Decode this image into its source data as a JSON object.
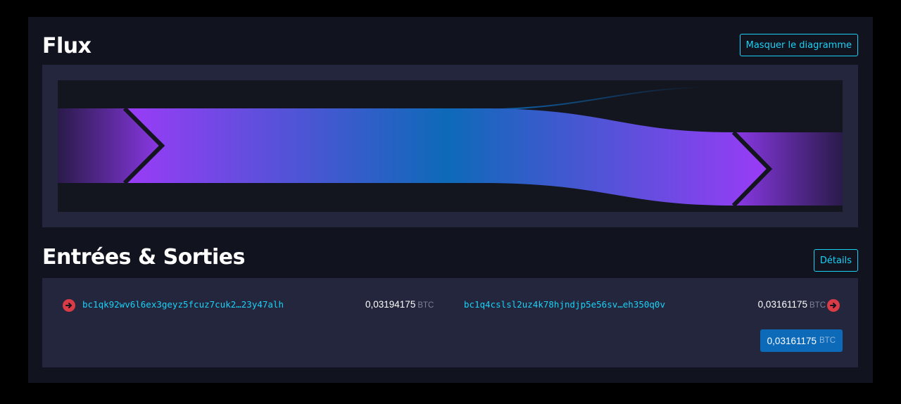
{
  "flux": {
    "title": "Flux",
    "hide_button": "Masquer le diagramme"
  },
  "io": {
    "title": "Entrées & Sorties",
    "details_button": "Détails",
    "inputs": [
      {
        "address": "bc1qk92wv6l6ex3geyz5fcuz7cuk2…23y47alh",
        "amount": "0,03194175",
        "unit": "BTC"
      }
    ],
    "outputs": [
      {
        "address": "bc1q4cslsl2uz4k78hjndjp5e56sv…eh350q0v",
        "amount": "0,03161175",
        "unit": "BTC"
      }
    ],
    "total": {
      "amount": "0,03161175",
      "unit": "BTC"
    }
  },
  "colors": {
    "accent": "#1bd1f5",
    "flow_purple": "#9b3bf7",
    "flow_blue": "#0d6ab8",
    "arrow_red": "#d93b47",
    "panel": "#24263e",
    "background": "#11131f"
  },
  "icons": {
    "input_arrow": "arrow-circle-right-icon",
    "output_arrow": "arrow-circle-right-icon"
  }
}
